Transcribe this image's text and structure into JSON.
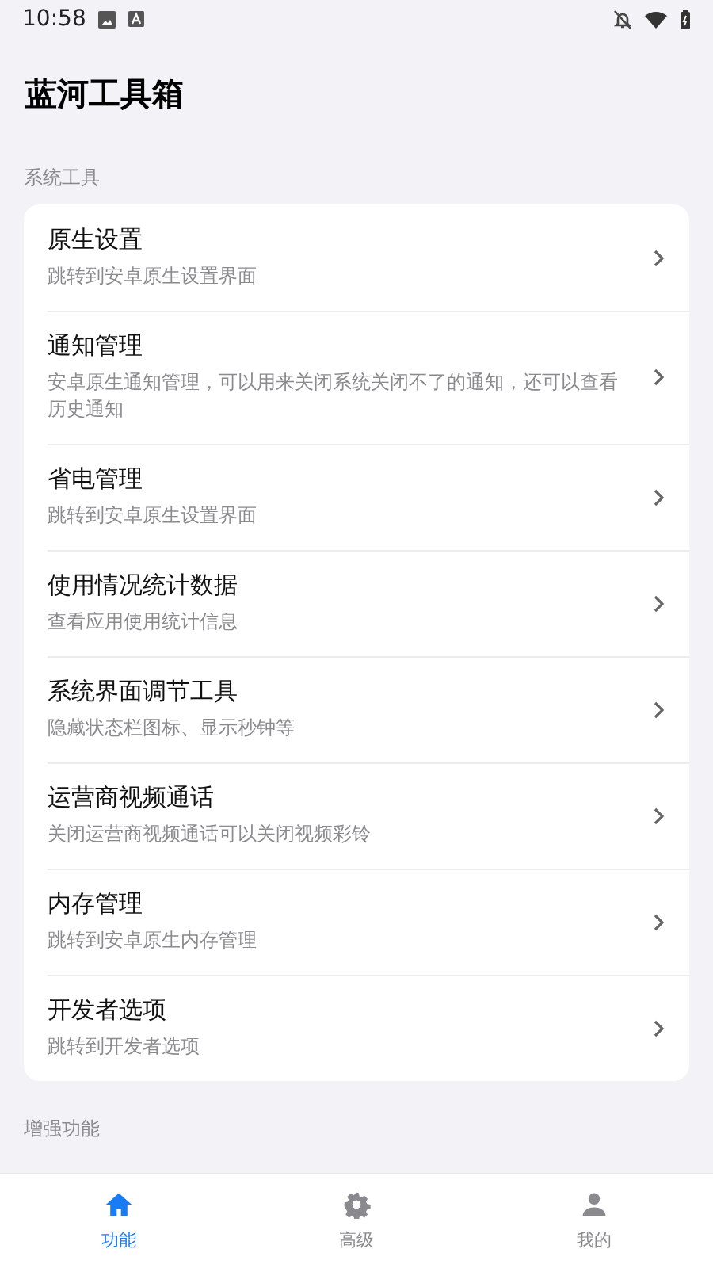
{
  "status_bar": {
    "time": "10:58"
  },
  "title": "蓝河工具箱",
  "sections": [
    {
      "label": "系统工具",
      "items": [
        {
          "title": "原生设置",
          "subtitle": "跳转到安卓原生设置界面"
        },
        {
          "title": "通知管理",
          "subtitle": "安卓原生通知管理，可以用来关闭系统关闭不了的通知，还可以查看历史通知"
        },
        {
          "title": "省电管理",
          "subtitle": "跳转到安卓原生设置界面"
        },
        {
          "title": "使用情况统计数据",
          "subtitle": "查看应用使用统计信息"
        },
        {
          "title": "系统界面调节工具",
          "subtitle": "隐藏状态栏图标、显示秒钟等"
        },
        {
          "title": "运营商视频通话",
          "subtitle": "关闭运营商视频通话可以关闭视频彩铃"
        },
        {
          "title": "内存管理",
          "subtitle": "跳转到安卓原生内存管理"
        },
        {
          "title": "开发者选项",
          "subtitle": "跳转到开发者选项"
        }
      ]
    },
    {
      "label": "增强功能"
    }
  ],
  "nav": [
    {
      "label": "功能",
      "kind": "home",
      "selected": true
    },
    {
      "label": "高级",
      "kind": "settings",
      "selected": false
    },
    {
      "label": "我的",
      "kind": "profile",
      "selected": false
    }
  ]
}
